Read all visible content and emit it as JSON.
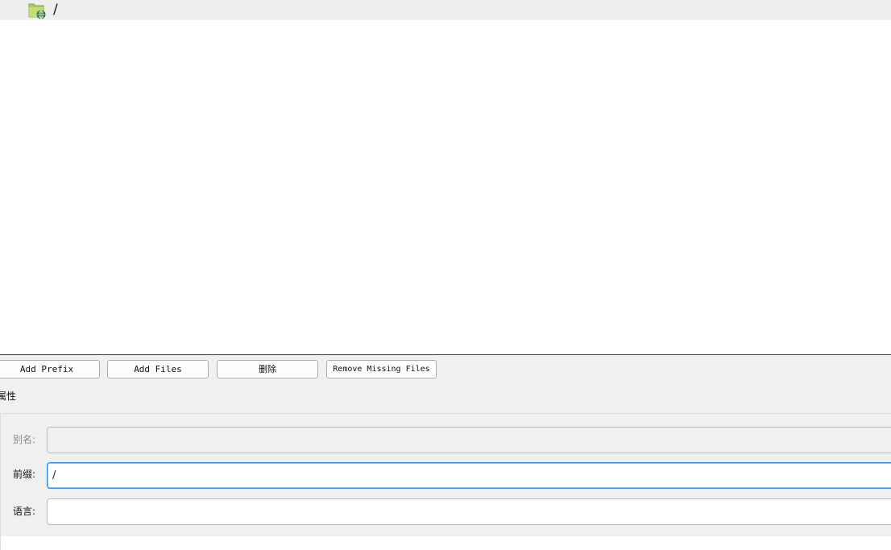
{
  "tree": {
    "root": {
      "icon": "folder-globe-icon",
      "label": "/"
    }
  },
  "toolbar": {
    "add_prefix": "Add Prefix",
    "add_files": "Add Files",
    "delete": "删除",
    "remove_missing": "Remove Missing Files"
  },
  "properties": {
    "title": "属性",
    "alias": {
      "label": "别名:",
      "value": "",
      "enabled": false
    },
    "prefix": {
      "label": "前缀:",
      "value": "/"
    },
    "language": {
      "label": "语言:",
      "value": ""
    }
  },
  "colors": {
    "tree_row_bg": "#efefef",
    "panel_bg": "#f0f0f0",
    "focus_border": "#2f8de4",
    "folder_icon": "#9acd32"
  }
}
